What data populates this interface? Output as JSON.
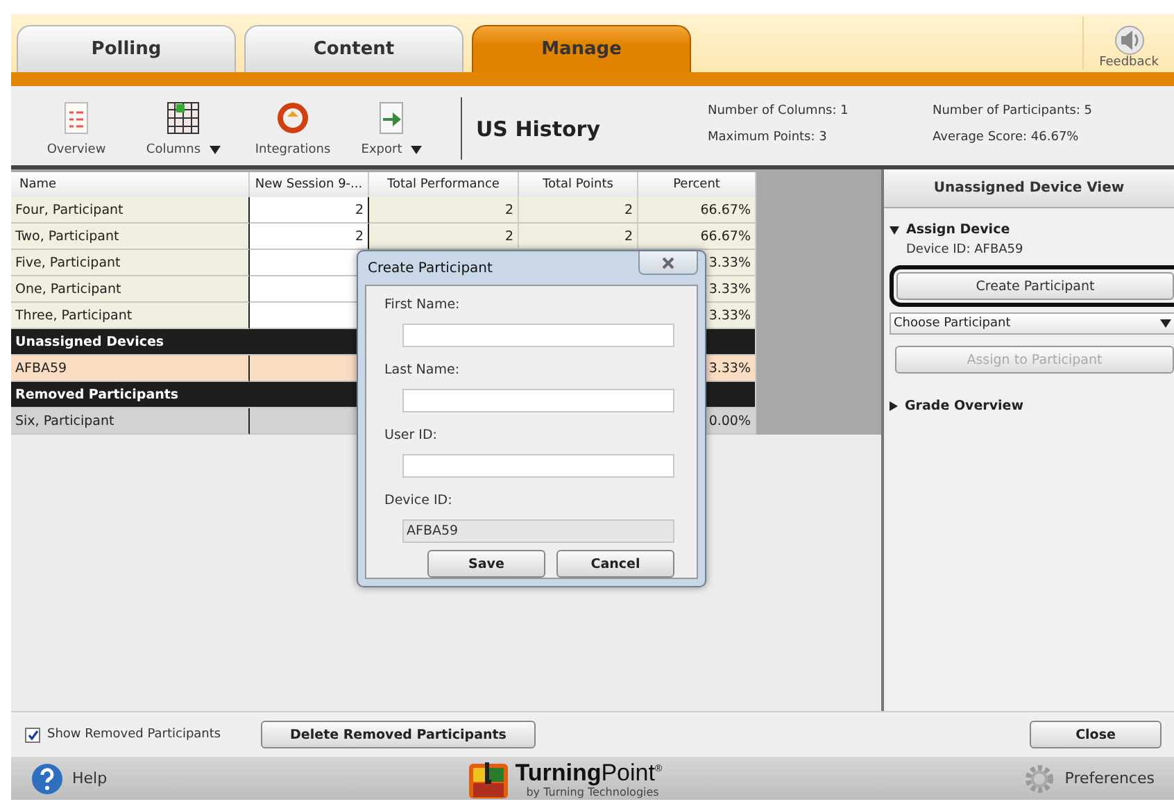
{
  "tabs": [
    {
      "label": "Polling",
      "selected": false
    },
    {
      "label": "Content",
      "selected": false
    },
    {
      "label": "Manage",
      "selected": true
    }
  ],
  "feedback": {
    "label": "Feedback"
  },
  "toolbar": [
    {
      "kind": "overview",
      "label": "Overview",
      "dropdown": false
    },
    {
      "kind": "columns",
      "label": "Columns",
      "dropdown": true
    },
    {
      "kind": "integrations",
      "label": "Integrations",
      "dropdown": false
    },
    {
      "kind": "export",
      "label": "Export",
      "dropdown": true
    }
  ],
  "title": "US History",
  "stats": [
    "Number of Columns: 1",
    "Maximum Points: 3",
    "Number of Participants: 5",
    "Average Score: 46.67%"
  ],
  "table": {
    "columns": [
      "Name",
      "New Session 9-...",
      "Total Performance",
      "Total Points",
      "Percent"
    ],
    "rows": [
      {
        "kind": "participant",
        "cells": [
          "Four, Participant",
          "2",
          "2",
          "2",
          "66.67%"
        ]
      },
      {
        "kind": "participant",
        "cells": [
          "Two, Participant",
          "2",
          "2",
          "2",
          "66.67%"
        ]
      },
      {
        "kind": "participant",
        "cells": [
          "Five, Participant",
          null,
          null,
          null,
          "3.33%"
        ]
      },
      {
        "kind": "participant",
        "cells": [
          "One, Participant",
          null,
          null,
          null,
          "3.33%"
        ]
      },
      {
        "kind": "participant",
        "cells": [
          "Three, Participant",
          null,
          null,
          null,
          "3.33%"
        ]
      },
      {
        "kind": "group",
        "cells": [
          "Unassigned Devices"
        ]
      },
      {
        "kind": "device",
        "cells": [
          "AFBA59",
          null,
          null,
          null,
          "3.33%"
        ]
      },
      {
        "kind": "group",
        "cells": [
          "Removed Participants"
        ]
      },
      {
        "kind": "removed",
        "cells": [
          "Six, Participant",
          null,
          null,
          null,
          "0.00%"
        ]
      }
    ]
  },
  "dialog": {
    "title": "Create Participant",
    "fields": [
      {
        "label": "First Name:",
        "readonly": false
      },
      {
        "label": "Last Name:",
        "readonly": false
      },
      {
        "label": "User ID:",
        "readonly": false
      },
      {
        "label": "Device ID:",
        "value": "AFBA59",
        "readonly": true
      }
    ],
    "buttons": [
      "Save",
      "Cancel"
    ]
  },
  "panel": {
    "title": "Unassigned Device View",
    "sections": [
      {
        "title": "Assign Device",
        "expanded": true,
        "device_id": "Device ID: AFBA59",
        "create_button": {
          "label": "Create Participant",
          "focused": true
        },
        "select": {
          "value": "Choose Participant"
        },
        "assign_button": {
          "label": "Assign to Participant",
          "disabled": true
        }
      },
      {
        "title": "Grade Overview",
        "expanded": false
      }
    ]
  },
  "bottom": {
    "checkbox": {
      "label": "Show Removed Participants",
      "checked": true
    },
    "delete_button": "Delete Removed Participants",
    "close_button": "Close"
  },
  "footer": {
    "help": "Help",
    "logo": "**Turning**Point$^{®}$",
    "byline": "by Turning Technologies",
    "preferences": "Preferences"
  }
}
